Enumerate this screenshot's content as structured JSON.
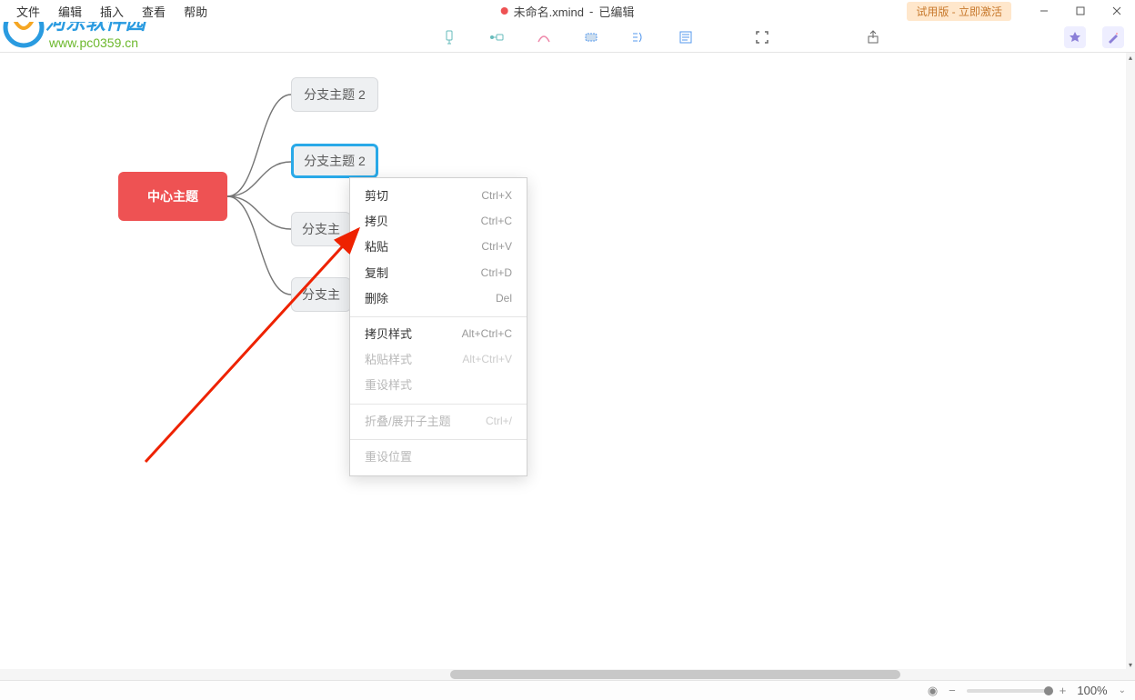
{
  "menubar": {
    "file": "文件",
    "edit": "编辑",
    "insert": "插入",
    "view": "查看",
    "help": "帮助"
  },
  "title": {
    "filename": "未命名.xmind",
    "status": "已编辑"
  },
  "trial_badge": "试用版 - 立即激活",
  "watermark": {
    "line1": "河东软件园",
    "line2": "www.pc0359.cn"
  },
  "nodes": {
    "central": "中心主题",
    "branch1": "分支主题 2",
    "branch2": "分支主题 2",
    "branch3": "分支主",
    "branch4": "分支主"
  },
  "context_menu": [
    {
      "label": "剪切",
      "shortcut": "Ctrl+X",
      "enabled": true
    },
    {
      "label": "拷贝",
      "shortcut": "Ctrl+C",
      "enabled": true
    },
    {
      "label": "粘贴",
      "shortcut": "Ctrl+V",
      "enabled": true
    },
    {
      "label": "复制",
      "shortcut": "Ctrl+D",
      "enabled": true
    },
    {
      "label": "删除",
      "shortcut": "Del",
      "enabled": true
    },
    {
      "sep": true
    },
    {
      "label": "拷贝样式",
      "shortcut": "Alt+Ctrl+C",
      "enabled": true
    },
    {
      "label": "粘贴样式",
      "shortcut": "Alt+Ctrl+V",
      "enabled": false
    },
    {
      "label": "重设样式",
      "shortcut": "",
      "enabled": false
    },
    {
      "sep": true
    },
    {
      "label": "折叠/展开子主题",
      "shortcut": "Ctrl+/",
      "enabled": false
    },
    {
      "sep": true
    },
    {
      "label": "重设位置",
      "shortcut": "",
      "enabled": false
    }
  ],
  "status": {
    "zoom": "100%"
  }
}
